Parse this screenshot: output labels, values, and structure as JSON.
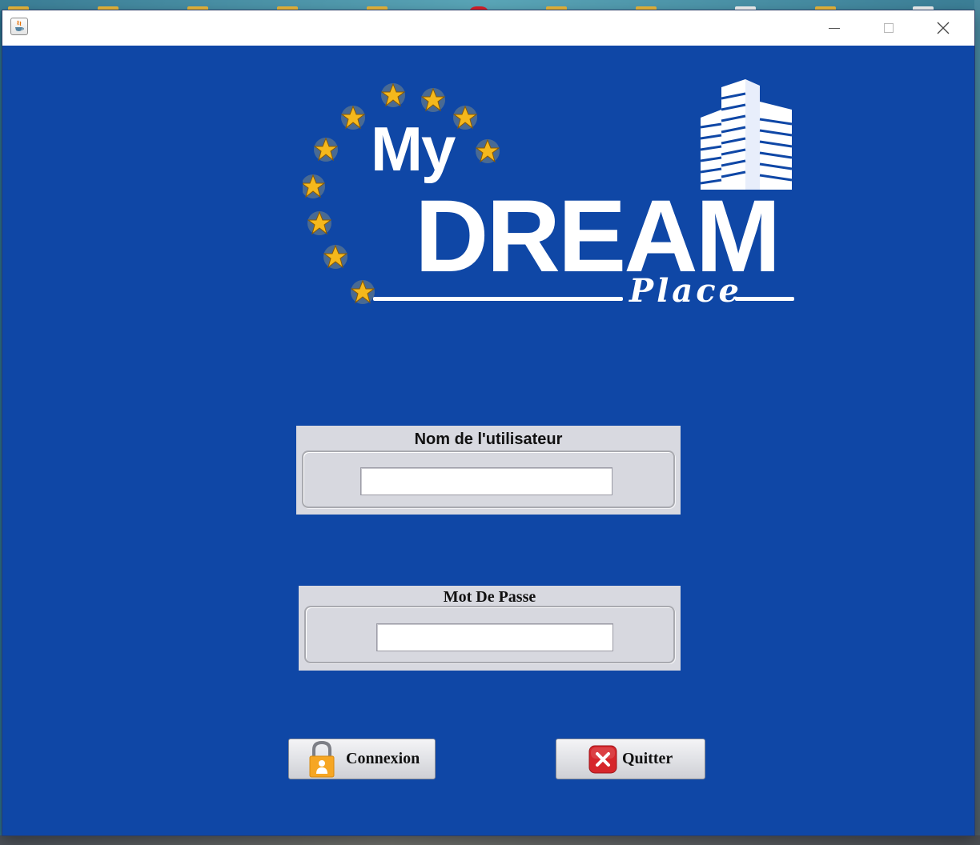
{
  "window": {
    "app_icon": "java-cup-icon",
    "controls": [
      "minimize-icon",
      "maximize-icon",
      "close-icon"
    ]
  },
  "logo": {
    "my": "My",
    "dream": "DREAM",
    "place": "Place"
  },
  "username": {
    "label": "Nom de l'utilisateur",
    "value": "",
    "placeholder": ""
  },
  "password": {
    "label": "Mot De Passe",
    "value": "",
    "placeholder": ""
  },
  "buttons": {
    "connexion": {
      "label": "Connexion",
      "icon": "padlock-user-icon"
    },
    "quitter": {
      "label": "Quitter",
      "icon": "red-x-icon"
    }
  },
  "colors": {
    "window_background": "#0f47a6",
    "panel_background": "#d8d9e0",
    "star_gold": "#f5b81c",
    "quit_red": "#d6262b",
    "lock_orange": "#f6a623"
  }
}
